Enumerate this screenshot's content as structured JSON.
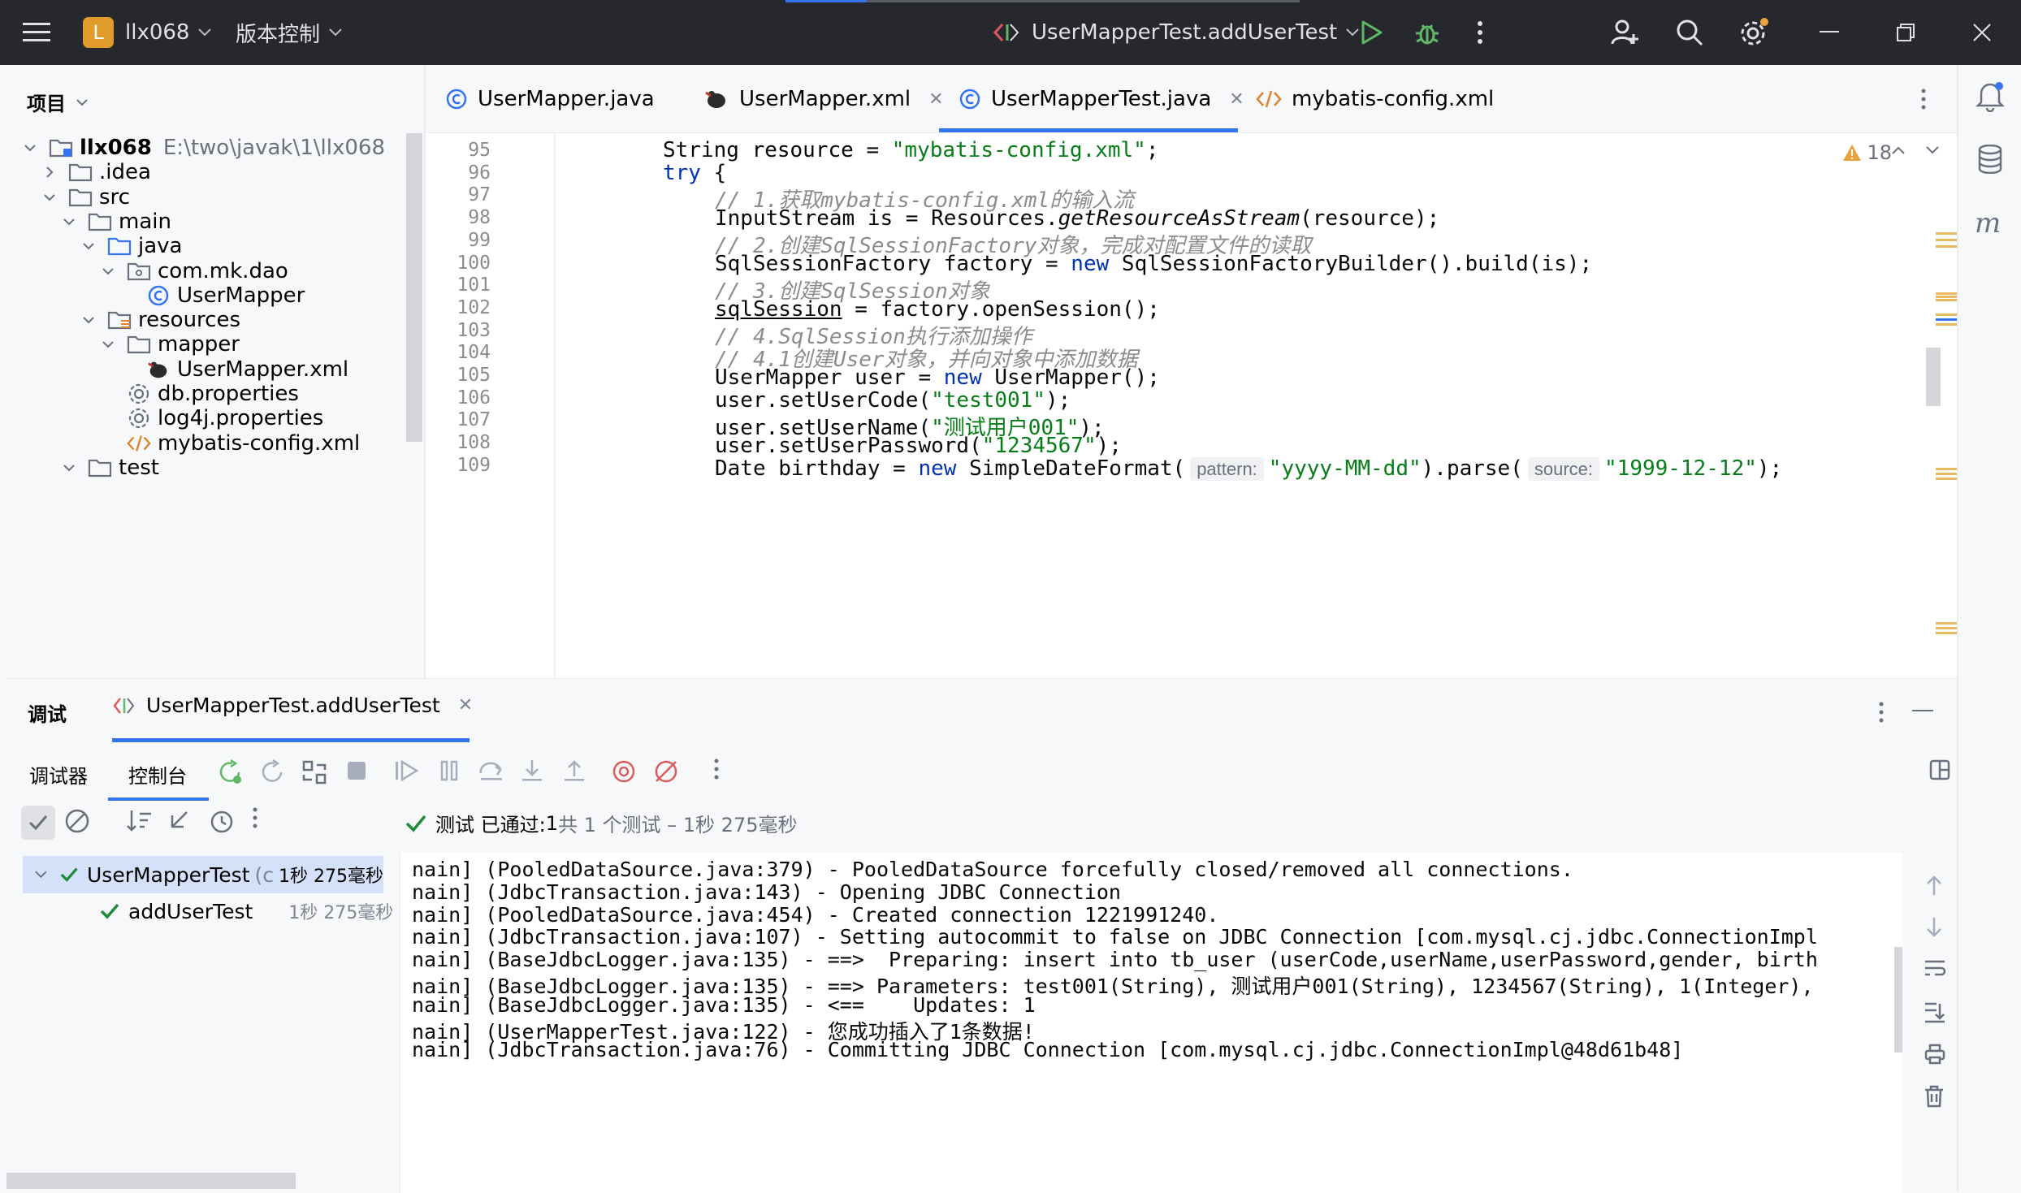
{
  "titlebar": {
    "project_badge": "L",
    "project_name": "llx068",
    "vcs_label": "版本控制",
    "run_config": "UserMapperTest.addUserTest"
  },
  "project_panel": {
    "header": "项目",
    "tree": [
      {
        "label": "llx068",
        "path": "E:\\two\\javak\\1\\llx068",
        "icon": "module-folder-icon",
        "expanded": true
      },
      {
        "label": ".idea",
        "icon": "folder-icon",
        "expanded": false
      },
      {
        "label": "src",
        "icon": "folder-icon",
        "expanded": true
      },
      {
        "label": "main",
        "icon": "folder-icon",
        "expanded": true
      },
      {
        "label": "java",
        "icon": "source-folder-icon",
        "expanded": true
      },
      {
        "label": "com.mk.dao",
        "icon": "package-icon",
        "expanded": true
      },
      {
        "label": "UserMapper",
        "icon": "class-icon"
      },
      {
        "label": "resources",
        "icon": "resources-folder-icon",
        "expanded": true
      },
      {
        "label": "mapper",
        "icon": "folder-icon",
        "expanded": true
      },
      {
        "label": "UserMapper.xml",
        "icon": "mybatis-icon"
      },
      {
        "label": "db.properties",
        "icon": "properties-icon"
      },
      {
        "label": "log4j.properties",
        "icon": "properties-icon"
      },
      {
        "label": "mybatis-config.xml",
        "icon": "xml-icon"
      },
      {
        "label": "test",
        "icon": "folder-icon",
        "expanded": true
      }
    ]
  },
  "editor": {
    "tabs": [
      {
        "label": "UserMapper.java",
        "icon": "class-icon",
        "active": false
      },
      {
        "label": "UserMapper.xml",
        "icon": "mybatis-icon",
        "active": false
      },
      {
        "label": "UserMapperTest.java",
        "icon": "class-icon",
        "active": true
      },
      {
        "label": "mybatis-config.xml",
        "icon": "xml-icon",
        "active": false
      }
    ],
    "warning_count": "18",
    "line_numbers": [
      "95",
      "96",
      "97",
      "98",
      "99",
      "100",
      "101",
      "102",
      "103",
      "104",
      "105",
      "106",
      "107",
      "108",
      "109"
    ],
    "code": {
      "l95_a": "String resource = ",
      "l95_b": "\"mybatis-config.xml\"",
      "l95_c": ";",
      "l96_a": "try",
      "l96_b": " {",
      "l97": "// 1.获取mybatis-config.xml的输入流",
      "l98_a": "InputStream is = Resources.",
      "l98_b": "getResourceAsStream",
      "l98_c": "(resource);",
      "l99": "// 2.创建SqlSessionFactory对象，完成对配置文件的读取",
      "l100_a": "SqlSessionFactory factory = ",
      "l100_b": "new",
      "l100_c": " SqlSessionFactoryBuilder().build(is);",
      "l101": "// 3.创建SqlSession对象",
      "l102_a": "sqlSession",
      "l102_b": " = factory.openSession();",
      "l103": "// 4.SqlSession执行添加操作",
      "l104": "// 4.1创建User对象，并向对象中添加数据",
      "l105_a": "UserMapper user = ",
      "l105_b": "new",
      "l105_c": " UserMapper();",
      "l106_a": "user.setUserCode(",
      "l106_b": "\"test001\"",
      "l106_c": ");",
      "l107_a": "user.setUserName(",
      "l107_b": "\"测试用户001\"",
      "l107_c": ");",
      "l108_a": "user.setUserPassword(",
      "l108_b": "\"1234567\"",
      "l108_c": ");",
      "l109_a": "Date birthday = ",
      "l109_b": "new",
      "l109_c": " SimpleDateFormat(",
      "l109_hint1": "pattern:",
      "l109_d": "\"yyyy-MM-dd\"",
      "l109_e": ").parse(",
      "l109_hint2": "source:",
      "l109_f": "\"1999-12-12\"",
      "l109_g": ");"
    }
  },
  "debug": {
    "title": "调试",
    "session_tab": "UserMapperTest.addUserTest",
    "tabs": [
      "调试器",
      "控制台"
    ],
    "status_prefix": "测试 已通过: ",
    "status_count": "1",
    "status_suffix": "共 1 个测试 – 1秒 275毫秒",
    "results": [
      {
        "label": "UserMapperTest",
        "extra": "(c",
        "time": "1秒 275毫秒"
      },
      {
        "label": "addUserTest",
        "time": "1秒 275毫秒"
      }
    ],
    "console_lines": [
      "nain] (PooledDataSource.java:379) - PooledDataSource forcefully closed/removed all connections.",
      "nain] (JdbcTransaction.java:143) - Opening JDBC Connection",
      "nain] (PooledDataSource.java:454) - Created connection 1221991240.",
      "nain] (JdbcTransaction.java:107) - Setting autocommit to false on JDBC Connection [com.mysql.cj.jdbc.ConnectionImpl",
      "nain] (BaseJdbcLogger.java:135) - ==>  Preparing: insert into tb_user (userCode,userName,userPassword,gender, birth",
      "nain] (BaseJdbcLogger.java:135) - ==> Parameters: test001(String), 测试用户001(String), 1234567(String), 1(Integer),",
      "nain] (BaseJdbcLogger.java:135) - <==    Updates: 1",
      "nain] (UserMapperTest.java:122) - 您成功插入了1条数据!",
      "nain] (JdbcTransaction.java:76) - Committing JDBC Connection [com.mysql.cj.jdbc.ConnectionImpl@48d61b48]"
    ]
  },
  "colors": {
    "titlebar_bg": "#27282e",
    "accent": "#3574f0",
    "success": "#208a3c",
    "keyword": "#0033b3",
    "string": "#067d17",
    "comment": "#8c8c8c",
    "warning": "#e8a33d"
  }
}
